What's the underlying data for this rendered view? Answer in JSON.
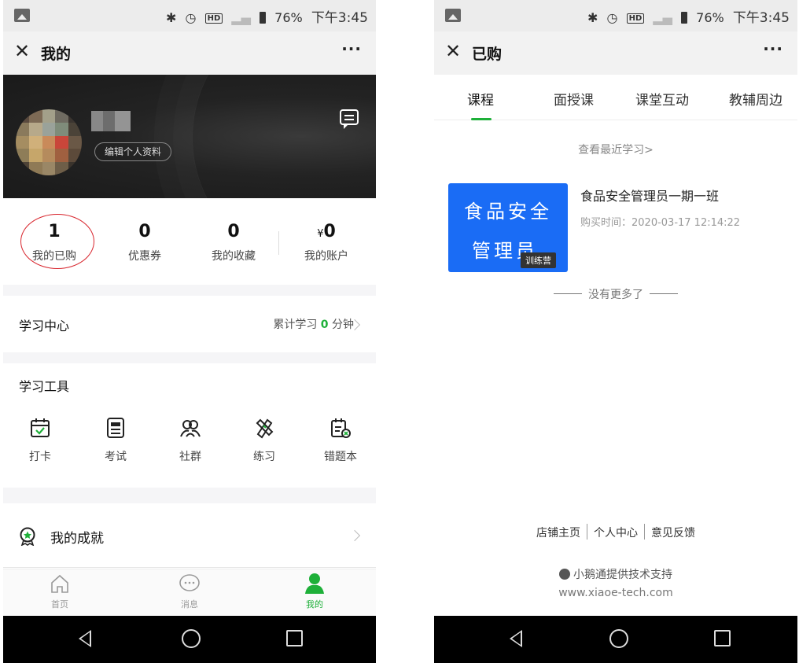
{
  "status_bar": {
    "battery": "76%",
    "time": "下午3:45",
    "hd_label": "HD"
  },
  "colors": {
    "accent": "#1eb039",
    "circle_annotation": "#d8252d",
    "course_blue": "#1a6cf5"
  },
  "left": {
    "title": "我的",
    "edit_profile": "编辑个人资料",
    "stats": [
      {
        "value": "1",
        "label": "我的已购"
      },
      {
        "value": "0",
        "label": "优惠券"
      },
      {
        "value": "0",
        "label": "我的收藏"
      },
      {
        "currency": "¥",
        "value": "0",
        "label": "我的账户"
      }
    ],
    "learning_center": {
      "title": "学习中心",
      "prefix": "累计学习 ",
      "minutes": "0",
      "suffix": " 分钟"
    },
    "tools": {
      "title": "学习工具",
      "items": [
        {
          "label": "打卡",
          "icon": "checkin-calendar-icon"
        },
        {
          "label": "考试",
          "icon": "exam-icon"
        },
        {
          "label": "社群",
          "icon": "community-icon"
        },
        {
          "label": "练习",
          "icon": "practice-icon"
        },
        {
          "label": "错题本",
          "icon": "wrong-questions-icon"
        }
      ]
    },
    "achievement": {
      "label": "我的成就",
      "icon": "medal-icon"
    },
    "tabbar": [
      {
        "label": "首页",
        "icon": "home-icon"
      },
      {
        "label": "消息",
        "icon": "message-icon"
      },
      {
        "label": "我的",
        "icon": "user-icon"
      }
    ]
  },
  "right": {
    "title": "已购",
    "tabs": [
      "课程",
      "面授课",
      "课堂互动",
      "教辅周边"
    ],
    "recent_link": "查看最近学习>",
    "course": {
      "thumb_line1": "食品安全",
      "thumb_line2": "管理员",
      "thumb_tag": "训练营",
      "title": "食品安全管理员一期一班",
      "purchase_time": "购买时间：2020-03-17 12:14:22"
    },
    "no_more": "没有更多了",
    "footer_links": [
      "店铺主页",
      "个人中心",
      "意见反馈"
    ],
    "powered_by": "小鹅通提供技术支持",
    "domain": "www.xiaoe-tech.com"
  }
}
